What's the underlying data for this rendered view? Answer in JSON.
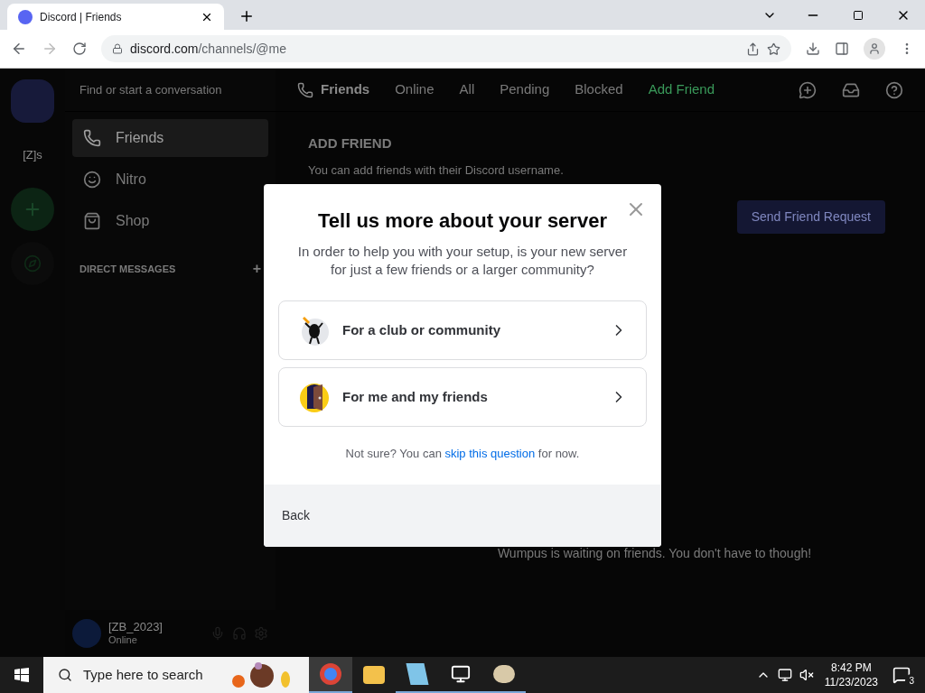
{
  "browser": {
    "tab_title": "Discord | Friends",
    "url_host": "discord.com",
    "url_path": "/channels/@me"
  },
  "discord": {
    "search_placeholder": "Find or start a conversation",
    "server_label": "[Z]s",
    "nav": [
      {
        "label": "Friends",
        "selected": true
      },
      {
        "label": "Nitro",
        "selected": false
      },
      {
        "label": "Shop",
        "selected": false
      }
    ],
    "dm_header": "DIRECT MESSAGES",
    "dm_add": "+",
    "header_title": "Friends",
    "header_tabs": [
      {
        "label": "Online",
        "kind": "tab"
      },
      {
        "label": "All",
        "kind": "tab"
      },
      {
        "label": "Pending",
        "kind": "tab"
      },
      {
        "label": "Blocked",
        "kind": "tab"
      },
      {
        "label": "Add Friend",
        "kind": "accent"
      }
    ],
    "add_friend_title": "ADD FRIEND",
    "add_friend_hint": "You can add friends with their Discord username.",
    "send_button": "Send Friend Request",
    "empty_text": "Wumpus is waiting on friends. You don't have to though!",
    "user": {
      "name": "[ZB_2023]",
      "status": "Online"
    }
  },
  "modal": {
    "title": "Tell us more about your server",
    "subtitle": "In order to help you with your setup, is your new server for just a few friends or a larger community?",
    "options": [
      {
        "label": "For a club or community",
        "kind": "club"
      },
      {
        "label": "For me and my friends",
        "kind": "friends"
      }
    ],
    "note_before": "Not sure? You can",
    "note_link": "skip this question",
    "note_after": "for now.",
    "back": "Back"
  },
  "taskbar": {
    "search_placeholder": "Type here to search",
    "time": "8:42 PM",
    "date": "11/23/2023",
    "notifications": "3"
  }
}
